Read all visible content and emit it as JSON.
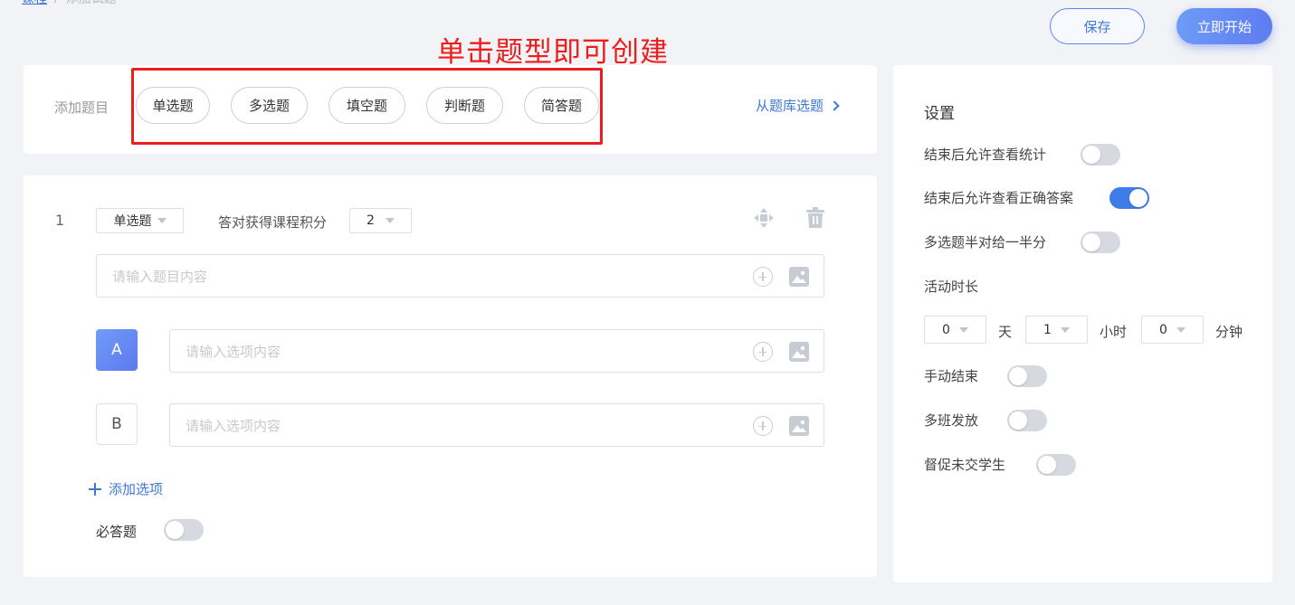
{
  "breadcrumb": {
    "parent": "课程",
    "current": "添加试题"
  },
  "header": {
    "save_label": "保存",
    "start_label": "立即开始"
  },
  "annotation": {
    "text": "单击题型即可创建",
    "color": "#ee1d1d"
  },
  "add_panel": {
    "label": "添加题目",
    "types": [
      "单选题",
      "多选题",
      "填空题",
      "判断题",
      "简答题"
    ],
    "bank_link": "从题库选题"
  },
  "question": {
    "number": "1",
    "type_value": "单选题",
    "score_label": "答对获得课程积分",
    "score_value": "2",
    "content_placeholder": "请输入题目内容",
    "options": [
      {
        "letter": "A",
        "placeholder": "请输入选项内容",
        "selected": true
      },
      {
        "letter": "B",
        "placeholder": "请输入选项内容",
        "selected": false
      }
    ],
    "add_option_label": "添加选项",
    "required_label": "必答题",
    "required_on": false
  },
  "settings": {
    "title": "设置",
    "toggles": [
      {
        "label": "结束后允许查看统计",
        "on": false
      },
      {
        "label": "结束后允许查看正确答案",
        "on": true
      },
      {
        "label": "多选题半对给一半分",
        "on": false
      }
    ],
    "duration": {
      "label": "活动时长",
      "days": "0",
      "days_unit": "天",
      "hours": "1",
      "hours_unit": "小时",
      "minutes": "0",
      "minutes_unit": "分钟"
    },
    "toggles_after": [
      {
        "label": "手动结束",
        "on": false
      },
      {
        "label": "多班发放",
        "on": false
      },
      {
        "label": "督促未交学生",
        "on": false
      }
    ]
  },
  "colors": {
    "accent": "#3e78d6",
    "toggle_on": "#3e7ce8",
    "background": "#f2f3f6"
  }
}
